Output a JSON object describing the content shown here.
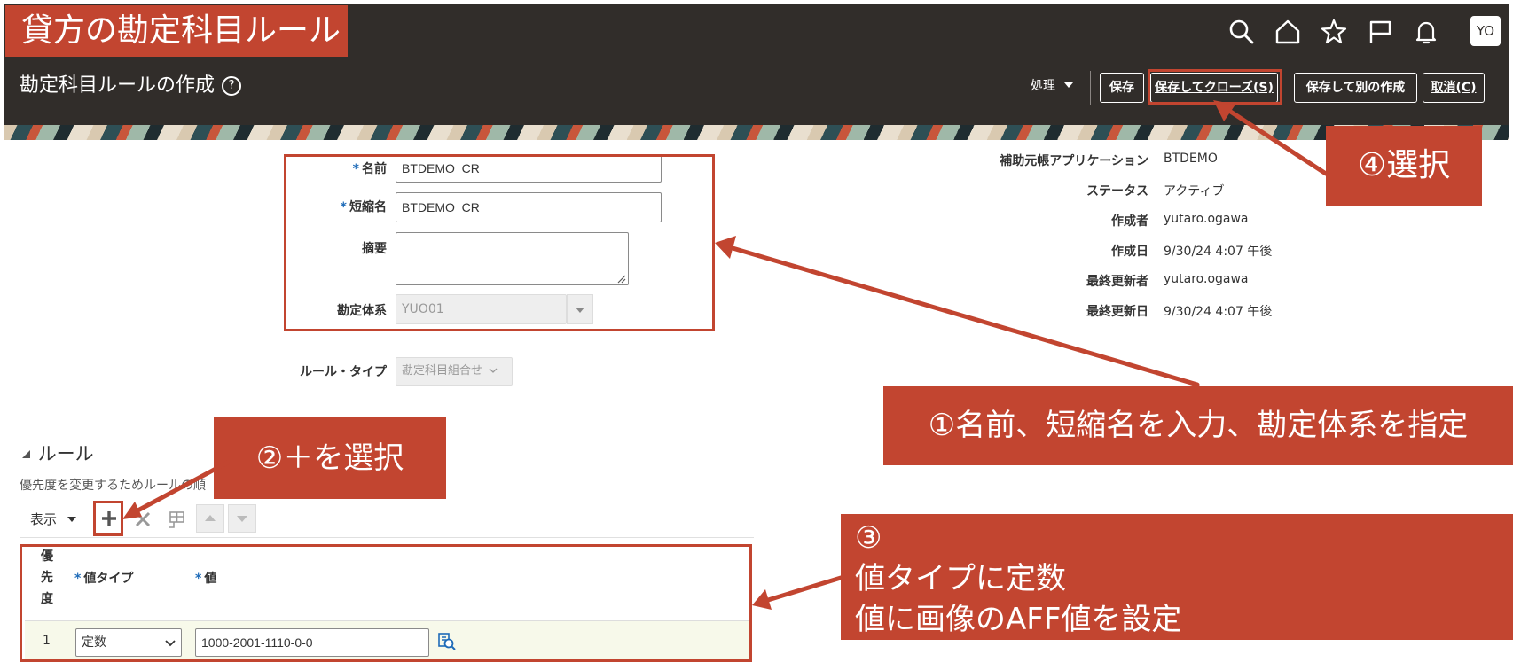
{
  "doc_title": "貸方の勘定科目ルール",
  "page": {
    "title": "勘定科目ルールの作成",
    "help_icon": "?"
  },
  "header": {
    "icons": [
      "search-icon",
      "home-icon",
      "star-icon",
      "flag-icon",
      "bell-icon"
    ],
    "avatar": "YO",
    "actions_label": "処理",
    "save": "保存",
    "save_close": "保存してクローズ(S)",
    "save_new": "保存して別の作成",
    "cancel": "取消(C)"
  },
  "form": {
    "name_label": "名前",
    "name_value": "BTDEMO_CR",
    "short_label": "短縮名",
    "short_value": "BTDEMO_CR",
    "desc_label": "摘要",
    "desc_value": "",
    "coa_label": "勘定体系",
    "coa_value": "YUO01",
    "rule_type_label": "ルール・タイプ",
    "rule_type_value": "勘定科目組合せ"
  },
  "info": [
    {
      "label": "補助元帳アプリケーション",
      "value": "BTDEMO"
    },
    {
      "label": "ステータス",
      "value": "アクティブ"
    },
    {
      "label": "作成者",
      "value": "yutaro.ogawa"
    },
    {
      "label": "作成日",
      "value": "9/30/24 4:07 午後"
    },
    {
      "label": "最終更新者",
      "value": "yutaro.ogawa"
    },
    {
      "label": "最終更新日",
      "value": "9/30/24 4:07 午後"
    }
  ],
  "rules": {
    "section_title": "ルール",
    "description": "優先度を変更するためルールの順",
    "view_label": "表示",
    "col_priority": "優\n先\n度",
    "col_value_type": "値タイプ",
    "col_value": "値",
    "rows": [
      {
        "priority": "1",
        "value_type": "定数",
        "value": "1000-2001-1110-0-0"
      }
    ]
  },
  "callouts": {
    "c1": "①名前、短縮名を入力、勘定体系を指定",
    "c2": "②＋を選択",
    "c3_num": "③",
    "c3_line1": "値タイプに定数",
    "c3_line2": "値に画像のAFF値を設定",
    "c4": "④選択"
  },
  "colors": {
    "header_bg": "#312d2a",
    "callout": "#c24530",
    "required": "#1e6bb8"
  }
}
